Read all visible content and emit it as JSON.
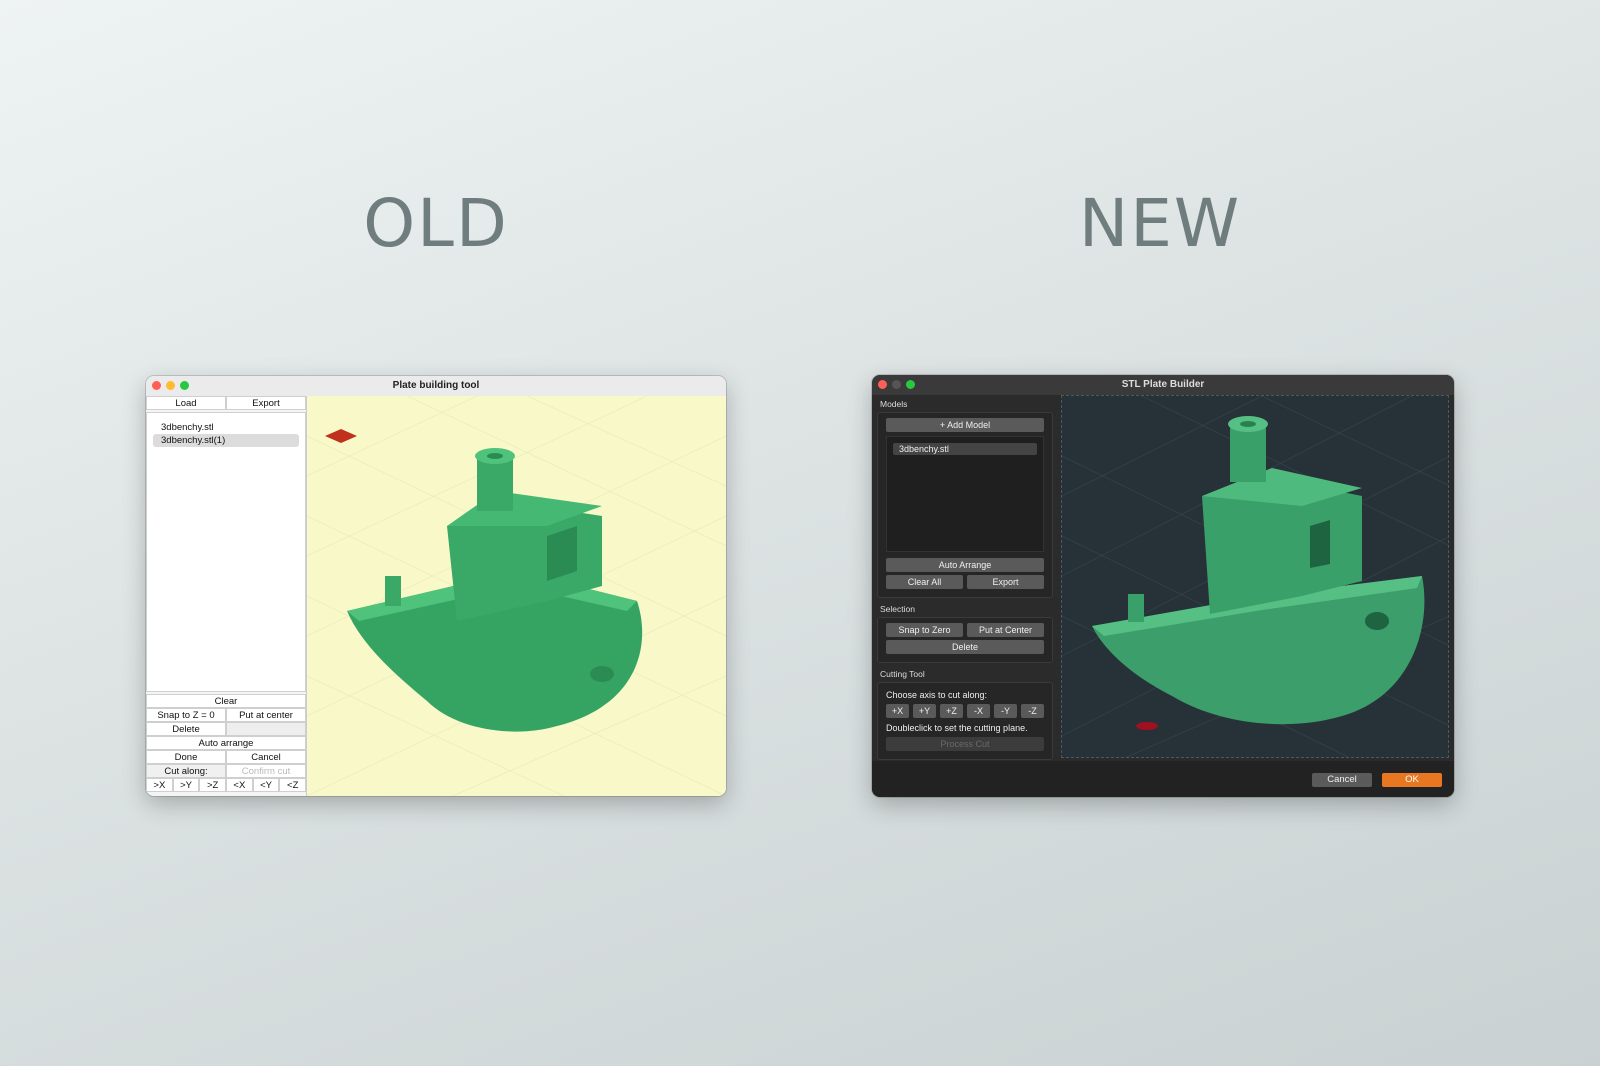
{
  "labels": {
    "old": "OLD",
    "new": "NEW"
  },
  "old": {
    "title": "Plate building tool",
    "load": "Load",
    "export": "Export",
    "models": [
      "3dbenchy.stl",
      "3dbenchy.stl(1)"
    ],
    "clear": "Clear",
    "snap": "Snap to Z = 0",
    "center": "Put at center",
    "delete": "Delete",
    "auto_arrange": "Auto arrange",
    "done": "Done",
    "cancel": "Cancel",
    "cut_along": "Cut along:",
    "confirm_cut": "Confirm cut",
    "axes": [
      ">X",
      ">Y",
      ">Z",
      "<X",
      "<Y",
      "<Z"
    ]
  },
  "new": {
    "title": "STL Plate Builder",
    "models_group": "Models",
    "add_model": "+ Add Model",
    "model_item": "3dbenchy.stl",
    "auto_arrange": "Auto Arrange",
    "clear_all": "Clear All",
    "export": "Export",
    "selection_group": "Selection",
    "snap_zero": "Snap to Zero",
    "put_center": "Put at Center",
    "delete": "Delete",
    "cutting_group": "Cutting Tool",
    "choose_axis": "Choose axis to cut along:",
    "axes": [
      "+X",
      "+Y",
      "+Z",
      "-X",
      "-Y",
      "-Z"
    ],
    "doubleclick": "Doubleclick to set the cutting plane.",
    "process_cut": "Process Cut",
    "cancel": "Cancel",
    "ok": "OK"
  },
  "colors": {
    "model_green": "#3fae6a",
    "ok_orange": "#e87722",
    "old_viewport": "#f8f8c8",
    "new_viewport": "#263238"
  }
}
